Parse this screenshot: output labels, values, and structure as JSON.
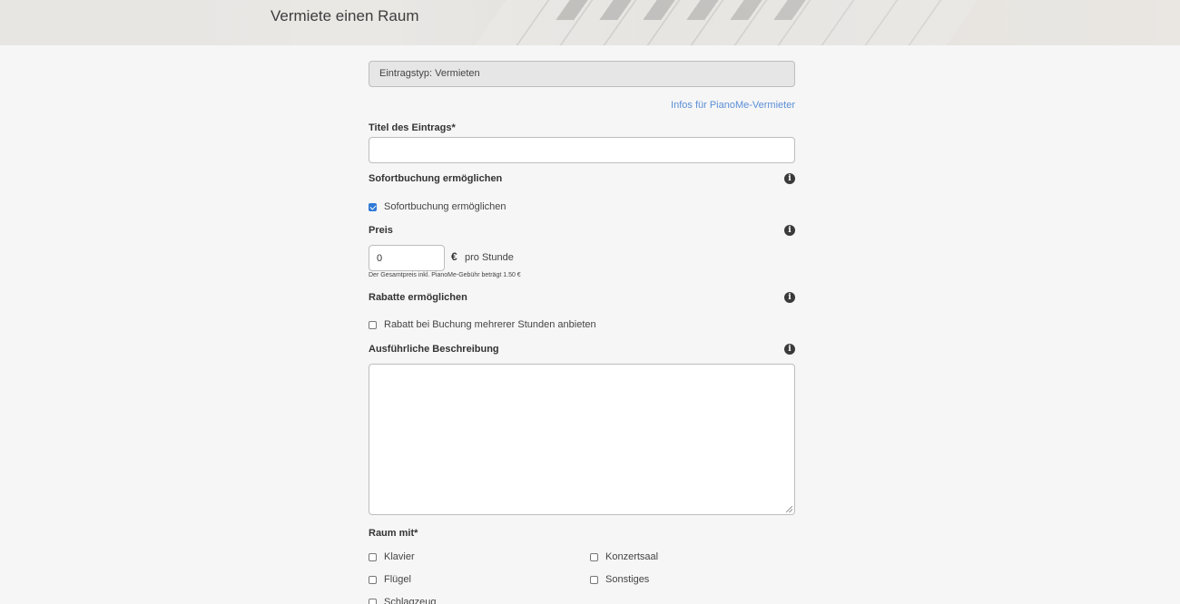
{
  "header": {
    "title": "Vermiete einen Raum"
  },
  "form": {
    "entry_type": "Eintragstyp: Vermieten",
    "info_link": "Infos für PianoMe-Vermieter",
    "title_label": "Titel des Eintrags*",
    "title_value": "",
    "instant_booking": {
      "section_label": "Sofortbuchung ermöglichen",
      "checkbox_label": "Sofortbuchung ermöglichen",
      "checked": true
    },
    "price": {
      "label": "Preis",
      "value": "0",
      "currency": "€",
      "unit": "pro Stunde",
      "fee_note": "Der Gesamtpreis inkl. PianoMe-Gebühr beträgt 1.50 €"
    },
    "discounts": {
      "section_label": "Rabatte ermöglichen",
      "checkbox_label": "Rabatt bei Buchung mehrerer Stunden anbieten",
      "checked": false
    },
    "description": {
      "label": "Ausführliche Beschreibung",
      "value": ""
    },
    "room_with": {
      "label": "Raum mit*",
      "options": [
        {
          "label": "Klavier",
          "checked": false
        },
        {
          "label": "Konzertsaal",
          "checked": false
        },
        {
          "label": "Flügel",
          "checked": false
        },
        {
          "label": "Sonstiges",
          "checked": false
        },
        {
          "label": "Schlagzeug",
          "checked": false
        }
      ]
    }
  },
  "icons": {
    "info": "info-icon",
    "info_glyph": "i"
  },
  "colors": {
    "link": "#5b8fd6",
    "checkbox_checked": "#2f7ad6",
    "background": "#f6f6f6"
  }
}
